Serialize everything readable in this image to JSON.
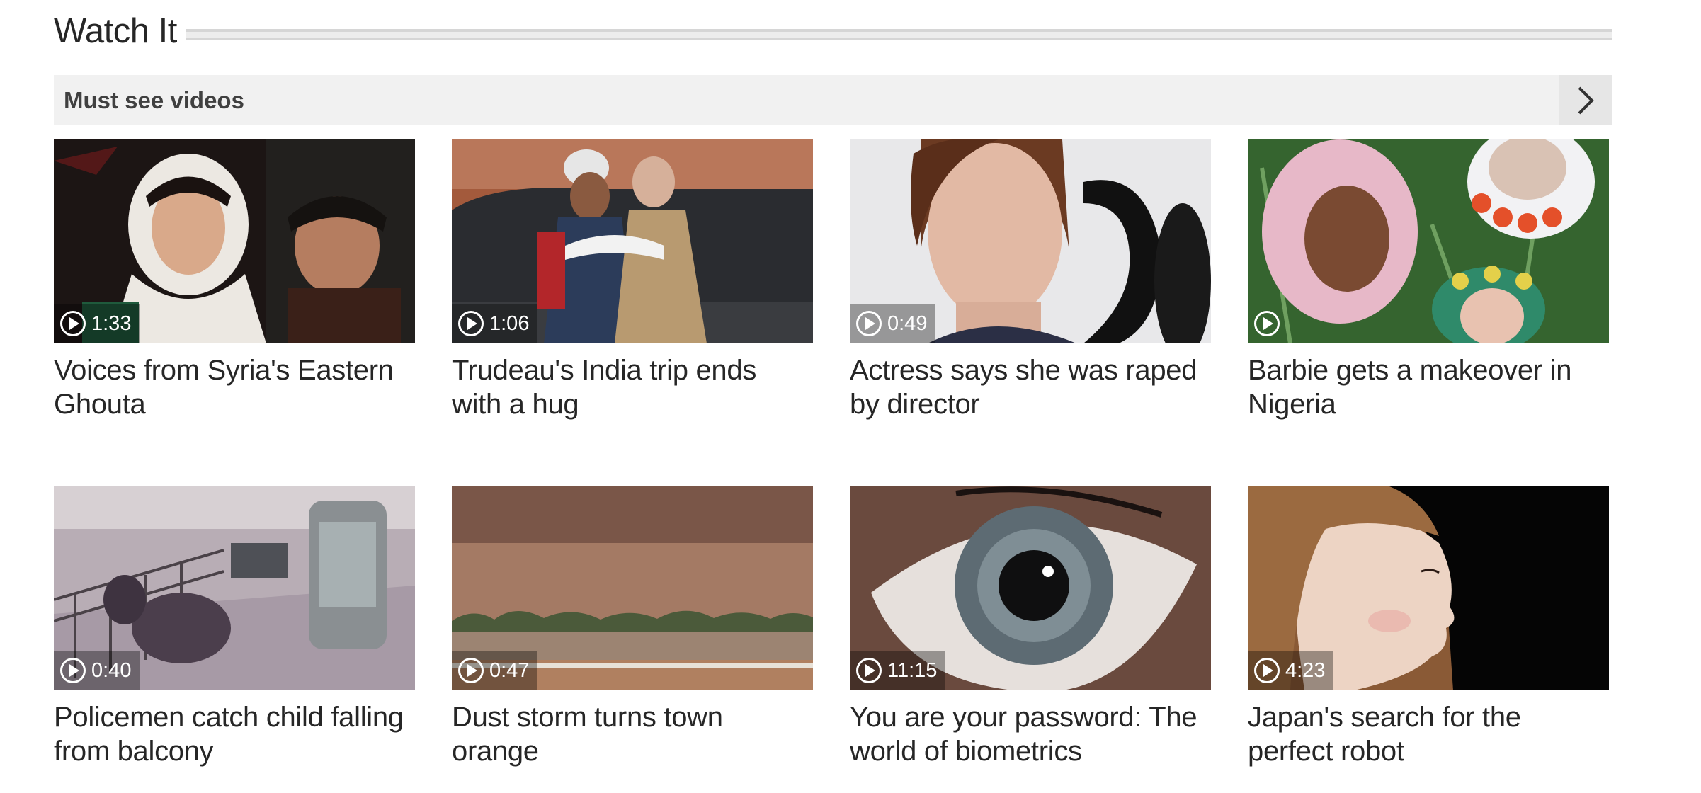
{
  "section": {
    "title": "Watch It"
  },
  "zone": {
    "title": "Must see videos",
    "next_icon": "chevron-right-icon"
  },
  "videos": [
    {
      "title": "Voices from Syria's Eastern Ghouta",
      "duration": "1:33"
    },
    {
      "title": "Trudeau's India trip ends with a hug",
      "duration": "1:06"
    },
    {
      "title": "Actress says she was raped by director",
      "duration": "0:49"
    },
    {
      "title": "Barbie gets a makeover in Nigeria",
      "duration": ""
    },
    {
      "title": "Policemen catch child falling from balcony",
      "duration": "0:40"
    },
    {
      "title": "Dust storm turns town orange",
      "duration": "0:47"
    },
    {
      "title": "You are your password: The world of biometrics",
      "duration": "11:15"
    },
    {
      "title": "Japan's search for the perfect robot",
      "duration": "4:23"
    }
  ],
  "icons": {
    "play": "play-circle-icon"
  },
  "colors": {
    "zone_bg": "#f1f1f1",
    "text": "#262626"
  }
}
